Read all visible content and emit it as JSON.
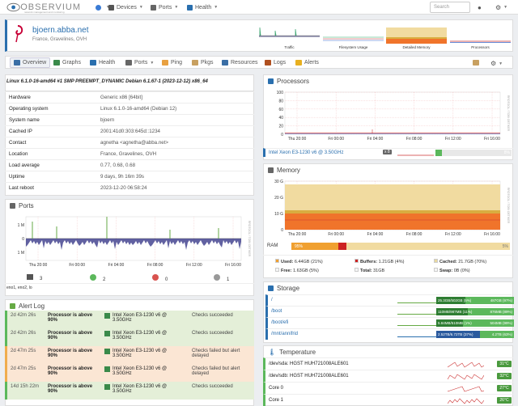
{
  "nav": {
    "logo": "OBSERVIUM",
    "logo_sub": "network management and monitoring",
    "devices": "Devices",
    "ports": "Ports",
    "health": "Health",
    "search_placeholder": "Search"
  },
  "header": {
    "hostname": "bjoern.abba.net",
    "location": "France, Gravelines, OVH",
    "graphs": [
      "Traffic",
      "Filesystem Usage",
      "Detailed Memory",
      "Processors"
    ]
  },
  "tabs": [
    "Overview",
    "Graphs",
    "Health",
    "Ports",
    "Ping",
    "Pkgs",
    "Resources",
    "Logs",
    "Alerts"
  ],
  "overview": {
    "kernel": "Linux 6.1.0-16-amd64 #1 SMP PREEMPT_DYNAMIC Debian 6.1.67-1 (2023-12-12) x86_64",
    "rows": [
      {
        "k": "Hardware",
        "v": "Generic x86 [64bit]"
      },
      {
        "k": "Operating system",
        "v": "Linux 6.1.0-16-amd64 (Debian 12)"
      },
      {
        "k": "System name",
        "v": "bjoern"
      },
      {
        "k": "Cached IP",
        "v": "2001:41d0:303:645d::1234"
      },
      {
        "k": "Contact",
        "v": "agnetha <agnetha@abba.net>"
      },
      {
        "k": "Location",
        "v": "France, Gravelines, OVH"
      },
      {
        "k": "Load average",
        "v": "0.77, 0.68, 0.68"
      },
      {
        "k": "Uptime",
        "v": "9 days, 9h 16m 39s"
      },
      {
        "k": "Last reboot",
        "v": "2023-12-20 06:58:24"
      }
    ]
  },
  "ports": {
    "title": "Ports",
    "y_labels": [
      "1 M",
      "0",
      "1 M"
    ],
    "x_labels": [
      "Thu 20:00",
      "Fri 00:00",
      "Fri 04:00",
      "Fri 08:00",
      "Fri 12:00",
      "Fri 16:00"
    ],
    "side_label": "RRDTOOL / TOBI OETIKER",
    "counts": [
      "3",
      "2",
      "0",
      "1"
    ],
    "list": "eno1, eno2, lo"
  },
  "alert_log": {
    "title": "Alert Log",
    "rows": [
      {
        "time": "2d 42m 26s",
        "alert": "Processor is above 90%",
        "entity": "Intel Xeon E3-1230 v6 @ 3.50GHz",
        "status": "Checks succeeded"
      },
      {
        "time": "2d 42m 26s",
        "alert": "Processor is above 90%",
        "entity": "Intel Xeon E3-1230 v6 @ 3.50GHz",
        "status": "Checks succeeded"
      },
      {
        "time": "2d 47m 25s",
        "alert": "Processor is above 90%",
        "entity": "Intel Xeon E3-1230 v6 @ 3.50GHz",
        "status": "Checks failed but alert delayed"
      },
      {
        "time": "2d 47m 25s",
        "alert": "Processor is above 90%",
        "entity": "Intel Xeon E3-1230 v6 @ 3.50GHz",
        "status": "Checks failed but alert delayed"
      },
      {
        "time": "14d 15h 22m",
        "alert": "Processor is above 90%",
        "entity": "Intel Xeon E3-1230 v6 @ 3.50GHz",
        "status": "Checks succeeded"
      }
    ]
  },
  "processors": {
    "title": "Processors",
    "y_labels": [
      "100",
      "80",
      "60",
      "40",
      "20",
      "0"
    ],
    "x_labels": [
      "Thu 20:00",
      "Fri 00:00",
      "Fri 04:00",
      "Fri 08:00",
      "Fri 12:00",
      "Fri 16:00"
    ],
    "side_label": "RRDTOOL / TOBI OETIKER",
    "cpu_name": "Intel Xeon E3-1230 v6 @ 3.50GHz",
    "cpu_count": "x 8",
    "cpu_pct": "8%",
    "cpu_value": 8
  },
  "memory": {
    "title": "Memory",
    "y_labels": [
      "30 G",
      "20 G",
      "10 G",
      "0"
    ],
    "x_labels": [
      "Thu 20:00",
      "Fri 00:00",
      "Fri 04:00",
      "Fri 08:00",
      "Fri 12:00",
      "Fri 16:00"
    ],
    "side_label": "RRDTOOL / TOBI OETIKER",
    "ram_label": "RAM",
    "ram_used": "95%",
    "ram_free": "5%",
    "legend": [
      {
        "label": "Used:",
        "value": "6.44GB (21%)",
        "color": "#f0a030"
      },
      {
        "label": "Buffers:",
        "value": "1.21GB (4%)",
        "color": "#cc2222"
      },
      {
        "label": "Cached:",
        "value": "21.7GB (70%)",
        "color": "#e8d8a0"
      },
      {
        "label": "Free:",
        "value": "1.63GB (5%)",
        "color": "#f5f5f5"
      },
      {
        "label": "Total:",
        "value": "31GB",
        "color": "#f5f5f5"
      },
      {
        "label": "Swap:",
        "value": "0B (0%)",
        "color": "#f5f5f5"
      }
    ]
  },
  "storage": {
    "title": "Storage",
    "rows": [
      {
        "mount": "/",
        "used": "25.3GB/502GB (5%)",
        "free": "487GB (97%)",
        "pct": 5
      },
      {
        "mount": "/boot",
        "used": "110MB/987MB (11%)",
        "free": "876MB (89%)",
        "pct": 11
      },
      {
        "mount": "/boot/efi",
        "used": "5.84MB/510MB (1%)",
        "free": "504MB (99%)",
        "pct": 1
      },
      {
        "mount": "/mnt/annifrid",
        "used": "2.52TB/6.72TB (37%)",
        "free": "4.2TB (63%)",
        "pct": 37
      }
    ]
  },
  "temperature": {
    "title": "Temperature",
    "rows": [
      {
        "name": "/dev/sda: HGST HUH721008ALE601",
        "value": "31°C"
      },
      {
        "name": "/dev/sdb: HGST HUH721008ALE601",
        "value": "32°C"
      },
      {
        "name": "Core 0",
        "value": "27°C"
      },
      {
        "name": "Core 1",
        "value": "26°C"
      }
    ]
  }
}
